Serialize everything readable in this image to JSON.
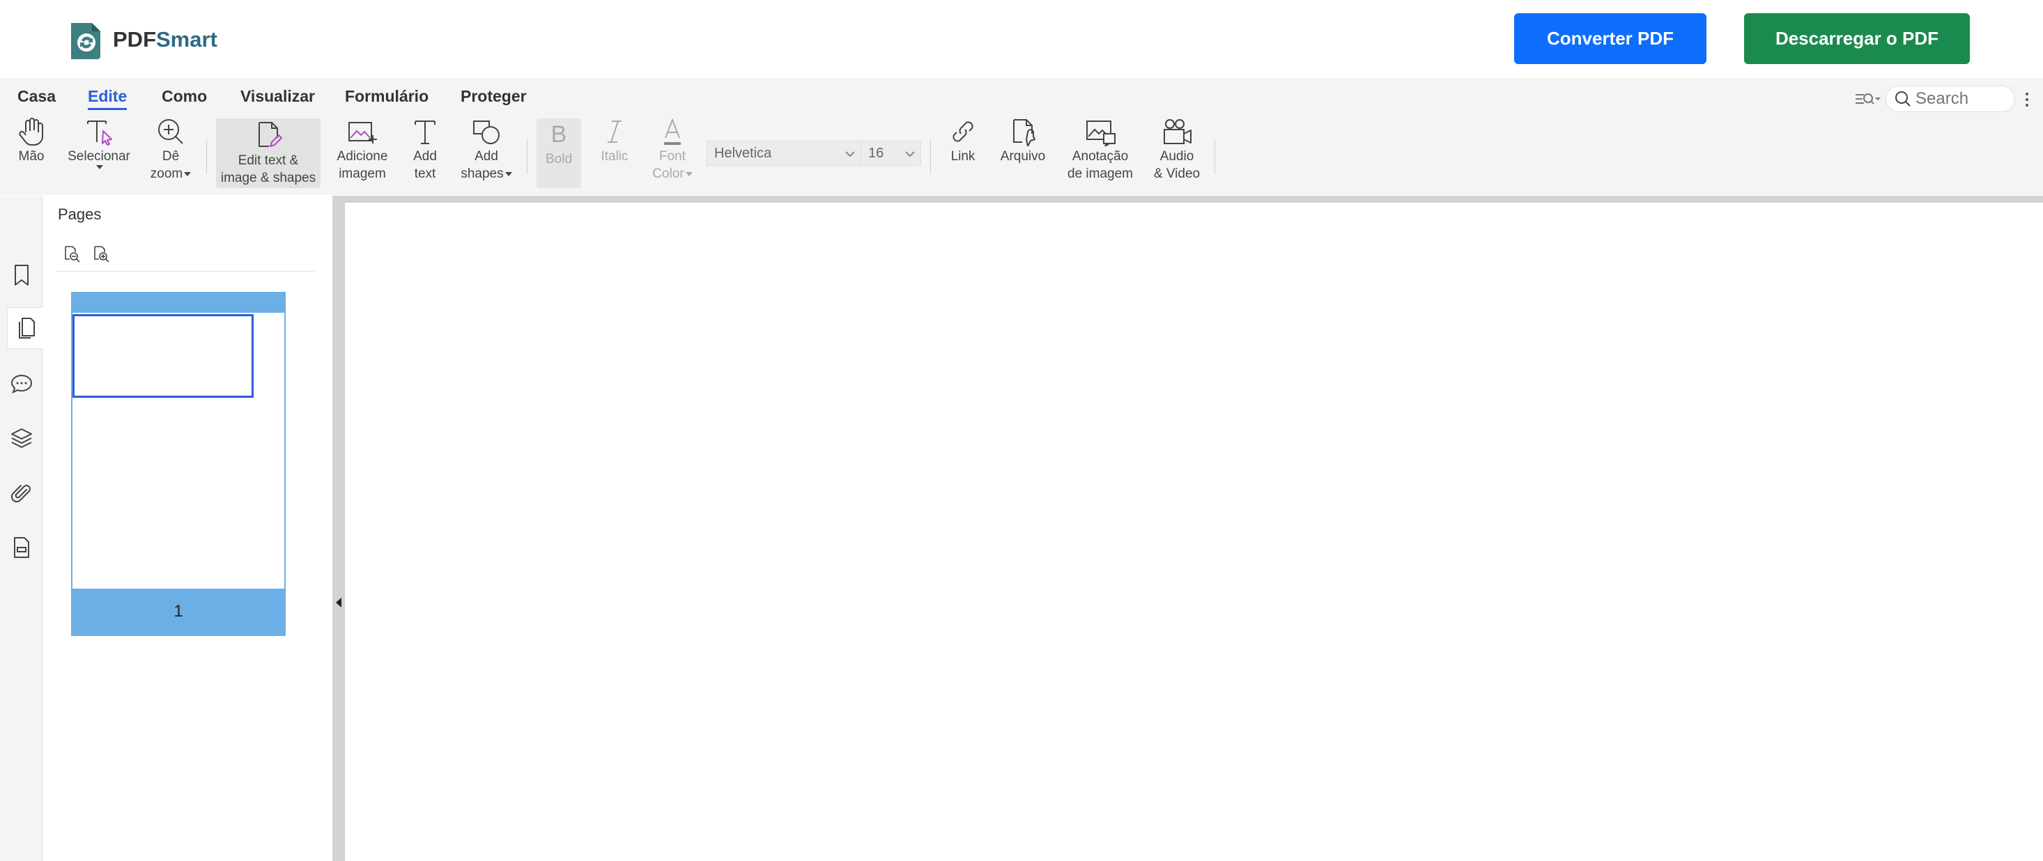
{
  "header": {
    "logo_prefix": "PDF",
    "logo_suffix": "Smart",
    "convert_button": "Converter PDF",
    "download_button": "Descarregar o PDF",
    "colors": {
      "convert": "#0d6efd",
      "download": "#1b8a4f",
      "logo_accent": "#2e6a86"
    }
  },
  "tabs": [
    {
      "label": "Casa",
      "active": false
    },
    {
      "label": "Edite",
      "active": true
    },
    {
      "label": "Como",
      "active": false
    },
    {
      "label": "Visualizar",
      "active": false
    },
    {
      "label": "Formulário",
      "active": false
    },
    {
      "label": "Proteger",
      "active": false
    }
  ],
  "search": {
    "placeholder": "Search",
    "value": ""
  },
  "tools": {
    "hand": {
      "label": "Mão",
      "icon": "hand-icon"
    },
    "select": {
      "label": "Selecionar",
      "icon": "select-text-icon"
    },
    "zoom": {
      "label1": "Dê",
      "label2": "zoom",
      "icon": "zoom-in-icon"
    },
    "edit": {
      "label1": "Edit text &",
      "label2": "image & shapes",
      "icon": "edit-document-icon"
    },
    "add_image": {
      "label1": "Adicione",
      "label2": "imagem",
      "icon": "add-image-icon"
    },
    "add_text": {
      "label1": "Add",
      "label2": "text",
      "icon": "text-icon"
    },
    "add_shapes": {
      "label1": "Add",
      "label2": "shapes",
      "icon": "shapes-icon"
    },
    "bold": {
      "label": "Bold",
      "icon": "bold-icon"
    },
    "italic": {
      "label": "Italic",
      "icon": "italic-icon"
    },
    "font_color": {
      "label1": "Font",
      "label2": "Color",
      "icon": "font-color-icon"
    },
    "font_family": "Helvetica",
    "font_size": "16",
    "link": {
      "label": "Link",
      "icon": "link-icon"
    },
    "file": {
      "label": "Arquivo",
      "icon": "file-attach-icon"
    },
    "image_annotation": {
      "label1": "Anotação",
      "label2": "de imagem",
      "icon": "image-annotation-icon"
    },
    "audio_video": {
      "label1": "Audio",
      "label2": "& Video",
      "icon": "video-camera-icon"
    }
  },
  "sidebar": {
    "pages_title": "Pages",
    "rail": [
      "bookmark-icon",
      "pages-icon",
      "comments-icon",
      "layers-icon",
      "attachment-icon",
      "form-fields-icon"
    ]
  },
  "thumbnails": [
    {
      "page_number": "1"
    }
  ]
}
